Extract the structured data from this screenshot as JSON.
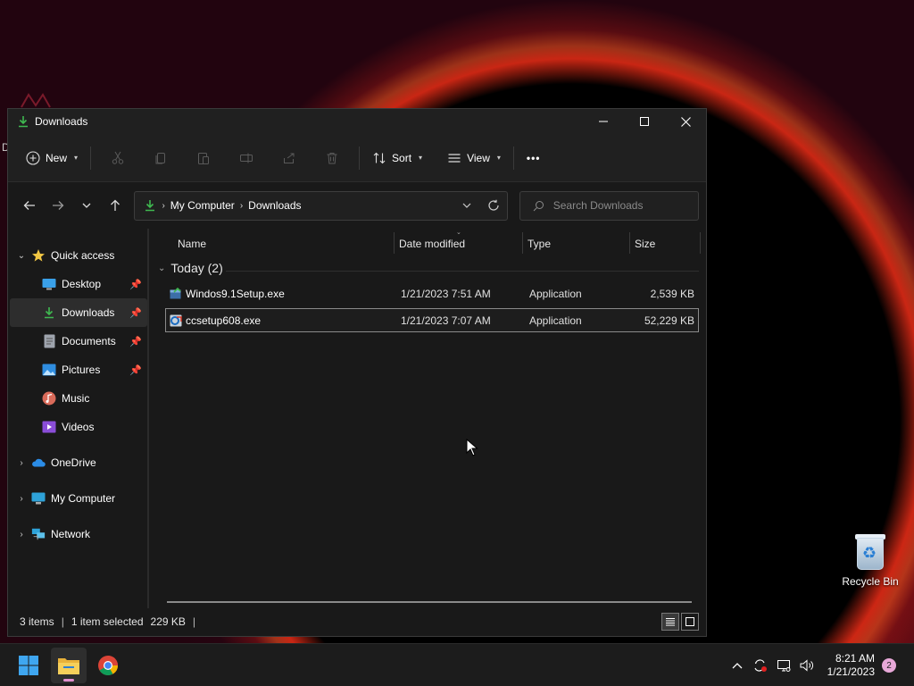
{
  "window": {
    "title": "Downloads",
    "controls": {
      "minimize": "─",
      "maximize": "☐",
      "close": "✕"
    }
  },
  "toolbar": {
    "new_label": "New",
    "sort_label": "Sort",
    "view_label": "View",
    "more_label": "•••"
  },
  "address": {
    "crumbs": [
      "My Computer",
      "Downloads"
    ],
    "search_placeholder": "Search Downloads"
  },
  "sidebar": {
    "items": [
      {
        "label": "Quick access",
        "icon": "star-icon"
      },
      {
        "label": "Desktop",
        "icon": "desktop-icon",
        "pinned": true
      },
      {
        "label": "Downloads",
        "icon": "download-icon",
        "pinned": true,
        "selected": true
      },
      {
        "label": "Documents",
        "icon": "document-icon",
        "pinned": true
      },
      {
        "label": "Pictures",
        "icon": "picture-icon",
        "pinned": true
      },
      {
        "label": "Music",
        "icon": "music-icon"
      },
      {
        "label": "Videos",
        "icon": "video-icon"
      },
      {
        "label": "OneDrive",
        "icon": "cloud-icon"
      },
      {
        "label": "My Computer",
        "icon": "computer-icon"
      },
      {
        "label": "Network",
        "icon": "network-icon"
      }
    ]
  },
  "columns": {
    "name": "Name",
    "date_modified": "Date modified",
    "type": "Type",
    "size": "Size"
  },
  "group": {
    "label": "Today (2)"
  },
  "files": [
    {
      "name": "Windos9.1Setup.exe",
      "date": "1/21/2023 7:51 AM",
      "type": "Application",
      "size": "2,539 KB"
    },
    {
      "name": "ccsetup608.exe",
      "date": "1/21/2023 7:07 AM",
      "type": "Application",
      "size": "52,229 KB",
      "selected": true
    }
  ],
  "status": {
    "items": "3 items",
    "selected": "1 item selected",
    "size": "229 KB"
  },
  "desktop": {
    "recycle_bin_label": "Recycle Bin",
    "stray_text": "D"
  },
  "taskbar": {
    "time": "8:21 AM",
    "date": "1/21/2023",
    "notification_count": "2"
  },
  "colors": {
    "accent_green": "#3fb950",
    "folder_yellow": "#f0c040",
    "window_bg": "#191919",
    "taskbar_bg": "#1c1c1c"
  }
}
